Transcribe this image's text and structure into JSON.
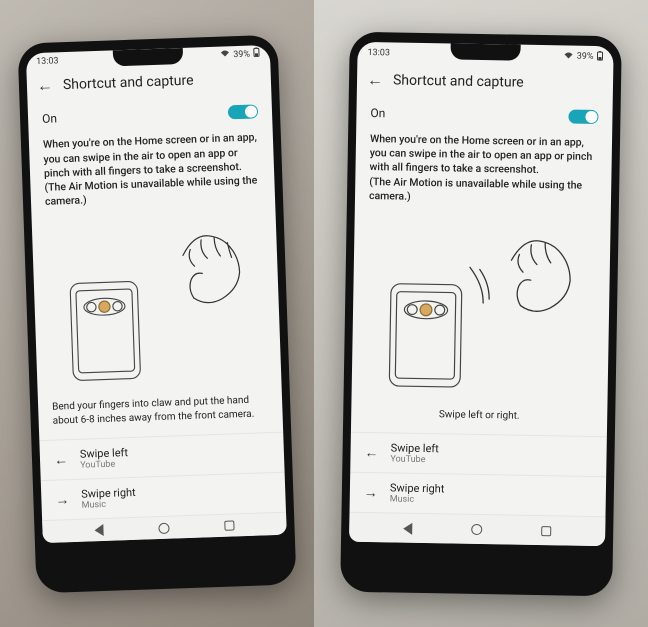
{
  "status": {
    "time": "13:03",
    "play_icon": "▸",
    "battery_pct": "39%"
  },
  "header": {
    "title": "Shortcut and capture"
  },
  "toggle": {
    "label": "On",
    "state": true
  },
  "description": "When you're on the Home screen or in an app, you can swipe in the air to open an app or pinch with all fingers to take a screenshot.\n(The Air Motion is unavailable while using the camera.)",
  "caption_left": "Bend your fingers into claw and put the hand about 6-8 inches away from the front camera.",
  "caption_right": "Swipe left or right.",
  "swipe_left": {
    "title": "Swipe left",
    "app": "YouTube"
  },
  "swipe_right": {
    "title": "Swipe right",
    "app": "Music"
  }
}
